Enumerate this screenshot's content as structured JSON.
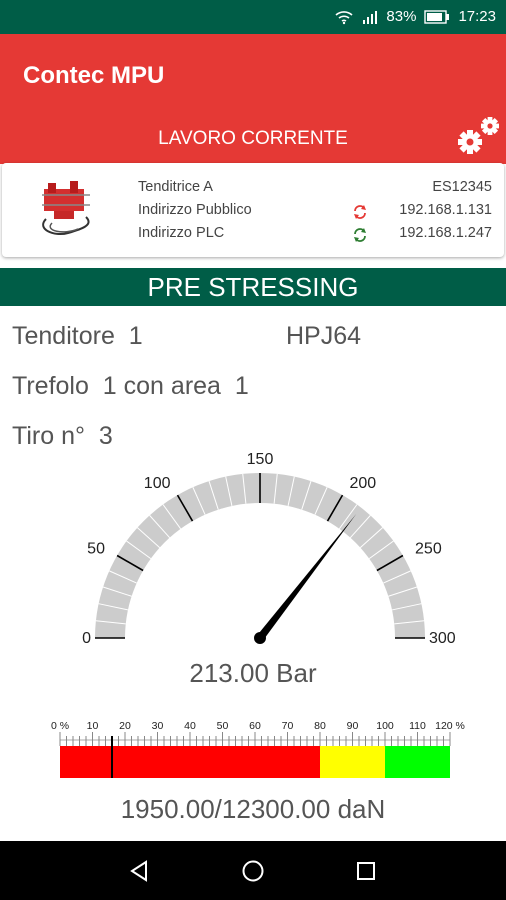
{
  "status_bar": {
    "battery": "83%",
    "time": "17:23"
  },
  "app": {
    "title": "Contec MPU",
    "section": "LAVORO CORRENTE"
  },
  "card": {
    "rows": [
      {
        "label": "Tenditrice A",
        "value": "ES12345"
      },
      {
        "label": "Indirizzo Pubblico",
        "value": "192.168.1.131",
        "icon": "sync-icon-red"
      },
      {
        "label": "Indirizzo PLC",
        "value": "192.168.1.247",
        "icon": "sync-icon-green"
      }
    ]
  },
  "band_title": "PRE STRESSING",
  "details": {
    "tenditore_label": "Tenditore",
    "tenditore_value": "1",
    "model": "HPJ64",
    "trefolo_label": "Trefolo",
    "trefolo_value": "1",
    "area_label": "con area",
    "area_value": "1",
    "tiro_label": "Tiro n°",
    "tiro_value": "3"
  },
  "gauge": {
    "value": 213.0,
    "min": 0,
    "max": 300,
    "ticks": [
      "0",
      "50",
      "100",
      "150",
      "200",
      "250",
      "300"
    ],
    "readout": "213.00 Bar"
  },
  "force_bar": {
    "labels": [
      "0 %",
      "10",
      "20",
      "30",
      "40",
      "50",
      "60",
      "70",
      "80",
      "90",
      "100",
      "110",
      "120 %"
    ],
    "marker_percent": 16,
    "zones": [
      {
        "from": 0,
        "to": 80,
        "color": "#ff0000"
      },
      {
        "from": 80,
        "to": 100,
        "color": "#ffff00"
      },
      {
        "from": 100,
        "to": 120,
        "color": "#00ff00"
      }
    ],
    "readout": "1950.00/12300.00  daN"
  },
  "colors": {
    "primary": "#e53935",
    "dark_green": "#005d47"
  }
}
